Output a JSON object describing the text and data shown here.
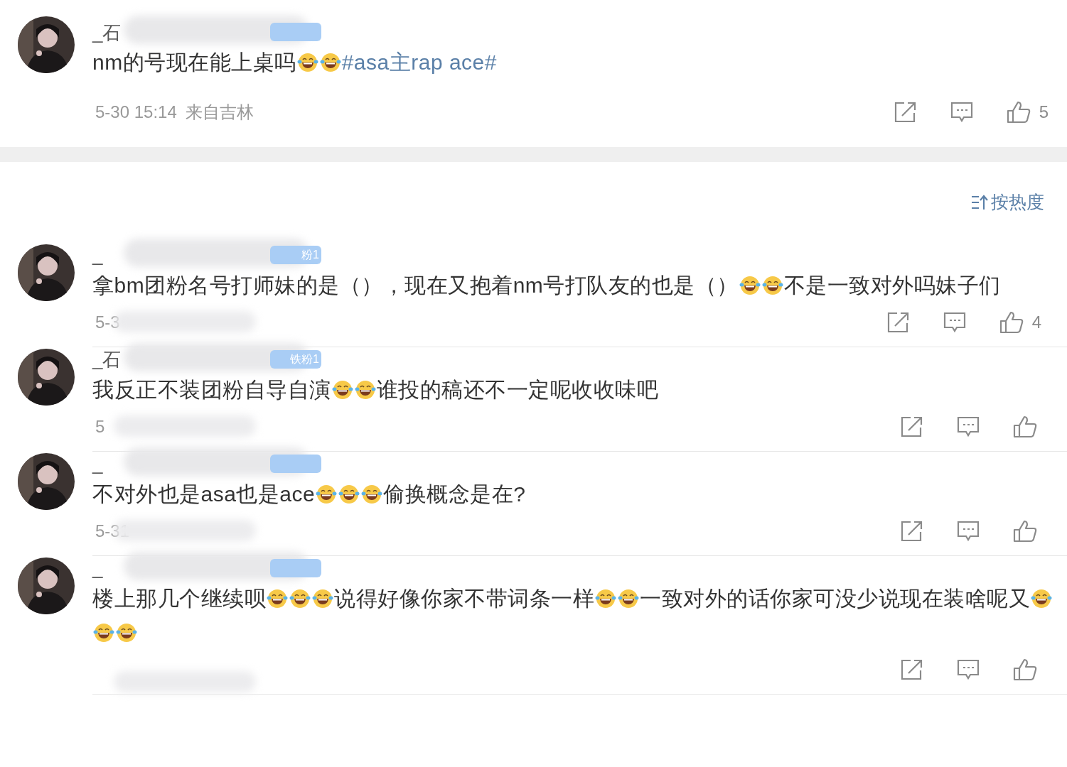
{
  "post": {
    "name": "_石",
    "segments": [
      {
        "kind": "text",
        "text": "nm的号现在能上桌吗"
      },
      {
        "kind": "emoji"
      },
      {
        "kind": "emoji"
      },
      {
        "kind": "topic",
        "text": "#asa主rap ace#"
      }
    ],
    "time": "5-30 15:14",
    "location": "来自吉林",
    "likes": "5"
  },
  "sort": {
    "label": "按热度"
  },
  "comments": [
    {
      "name": "_",
      "badge": "粉1",
      "segments": [
        {
          "kind": "text",
          "text": "拿bm团粉名号打师妹的是（），现在又抱着nm号打队友的也是（）"
        },
        {
          "kind": "emoji"
        },
        {
          "kind": "emoji"
        },
        {
          "kind": "text",
          "text": "不是一致对外吗妹子们"
        }
      ],
      "time": "5-3",
      "likes": "4"
    },
    {
      "name": "_石",
      "badge": "铁粉1",
      "segments": [
        {
          "kind": "text",
          "text": "我反正不装团粉自导自演"
        },
        {
          "kind": "emoji"
        },
        {
          "kind": "emoji"
        },
        {
          "kind": "text",
          "text": "谁投的稿还不一定呢收收味吧"
        }
      ],
      "time": "5"
    },
    {
      "name": "_",
      "segments": [
        {
          "kind": "text",
          "text": "不对外也是asa也是ace"
        },
        {
          "kind": "emoji"
        },
        {
          "kind": "emoji"
        },
        {
          "kind": "emoji"
        },
        {
          "kind": "text",
          "text": "偷换概念是在?"
        }
      ],
      "time": "5-31"
    },
    {
      "name": "_",
      "segments": [
        {
          "kind": "text",
          "text": "楼上那几个继续呗"
        },
        {
          "kind": "emoji"
        },
        {
          "kind": "emoji"
        },
        {
          "kind": "emoji"
        },
        {
          "kind": "text",
          "text": "说得好像你家不带词条一样"
        },
        {
          "kind": "emoji"
        },
        {
          "kind": "emoji"
        },
        {
          "kind": "text",
          "text": "一致对外的话你家可没少说现在装啥呢又"
        },
        {
          "kind": "emoji"
        },
        {
          "kind": "emoji"
        },
        {
          "kind": "emoji"
        }
      ]
    }
  ]
}
